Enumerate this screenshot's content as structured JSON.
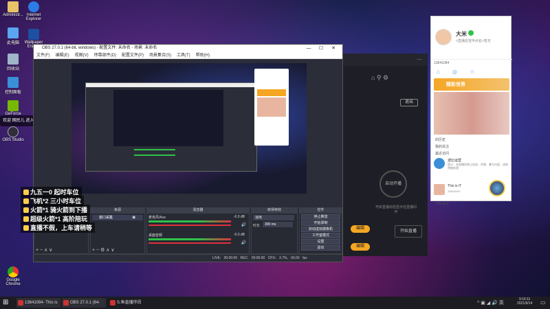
{
  "desktop": {
    "icons": [
      {
        "label": "Administr..."
      },
      {
        "label": "Internet Explorer"
      },
      {
        "label": "此电脑"
      },
      {
        "label": "Wallpaper Engine"
      },
      {
        "label": "回收站"
      },
      {
        "label": "控制面板"
      },
      {
        "label": "GeForce"
      },
      {
        "label": "OBS Studio"
      },
      {
        "label": "Google Chrome"
      }
    ],
    "overlay_notice": "欢迎 网民儿 进入直播间"
  },
  "captions": [
    "九五一0 起时车位",
    "飞机*2 三小时车位",
    "火箭*1 骑火箭到下播",
    "超级火箭*1 高阶陪玩",
    "直播不假，上车请稍等"
  ],
  "obs": {
    "title": "OBS 27.0.1 (64-bit, windows) - 配置文件: 未命名 - 场景: 未命名",
    "menu": [
      "文件(F)",
      "编辑(E)",
      "视图(V)",
      "停靠部件(D)",
      "配置文件(P)",
      "场景集合(S)",
      "工具(T)",
      "帮助(H)"
    ],
    "window_buttons": [
      "—",
      "☐",
      "✕"
    ],
    "panels": {
      "scenes_title": "场景",
      "sources_title": "来源",
      "mixer_title": "混音器",
      "transitions_title": "转场特效",
      "controls_title": "控件"
    },
    "source_item": "窗口采集",
    "mixer": [
      {
        "name": "麦克风/Aux",
        "level": "-0.0 dB"
      },
      {
        "name": "桌面音频",
        "level": "-0.0 dB"
      }
    ],
    "transition": {
      "type": "淡出",
      "duration_label": "时长",
      "duration": "300 ms"
    },
    "controls": [
      "停止推流",
      "开始录制",
      "启动虚拟摄像机",
      "工作室模式",
      "设置",
      "退出"
    ],
    "status": {
      "live": "LIVE: 00:00:00",
      "rec": "REC: 00:00:00",
      "cpu": "CPU: 3.7%, 60.00 fps"
    }
  },
  "companion": {
    "stop_live": "退出",
    "auto_open": "自动开播",
    "hint": "开启直播动态显示在直播间中",
    "btn1": "编辑",
    "btn2": "编辑",
    "btn3": "编辑",
    "start_button": "开始直播"
  },
  "chat": {
    "user_name": "大米",
    "user_sub": "<直播店宣传点名>暂无",
    "room_id": "13641094",
    "banner": "精彩世界",
    "entries": [
      "的历史",
      "我的关注",
      "最近访问"
    ],
    "message_1": {
      "name": "波比运营",
      "text": "提示：本直播间禁止低俗、色情、暴力内容，违规将被处理"
    },
    "message_2_name": "This is IT",
    "message_2_sub": "13641094",
    "footer_name": "This is IT"
  },
  "taskbar": {
    "tasks": [
      "13641094- This is IT",
      "OBS 27.0.1 (64-bi...",
      "S.鱼直播伴侣"
    ],
    "time": "9:19:11",
    "date": "2021/9/14"
  },
  "colors": {
    "accent_orange": "#f5a623",
    "obs_bg": "#2b2e38",
    "meter_green": "#2ec24a",
    "meter_red": "#e0303a"
  }
}
